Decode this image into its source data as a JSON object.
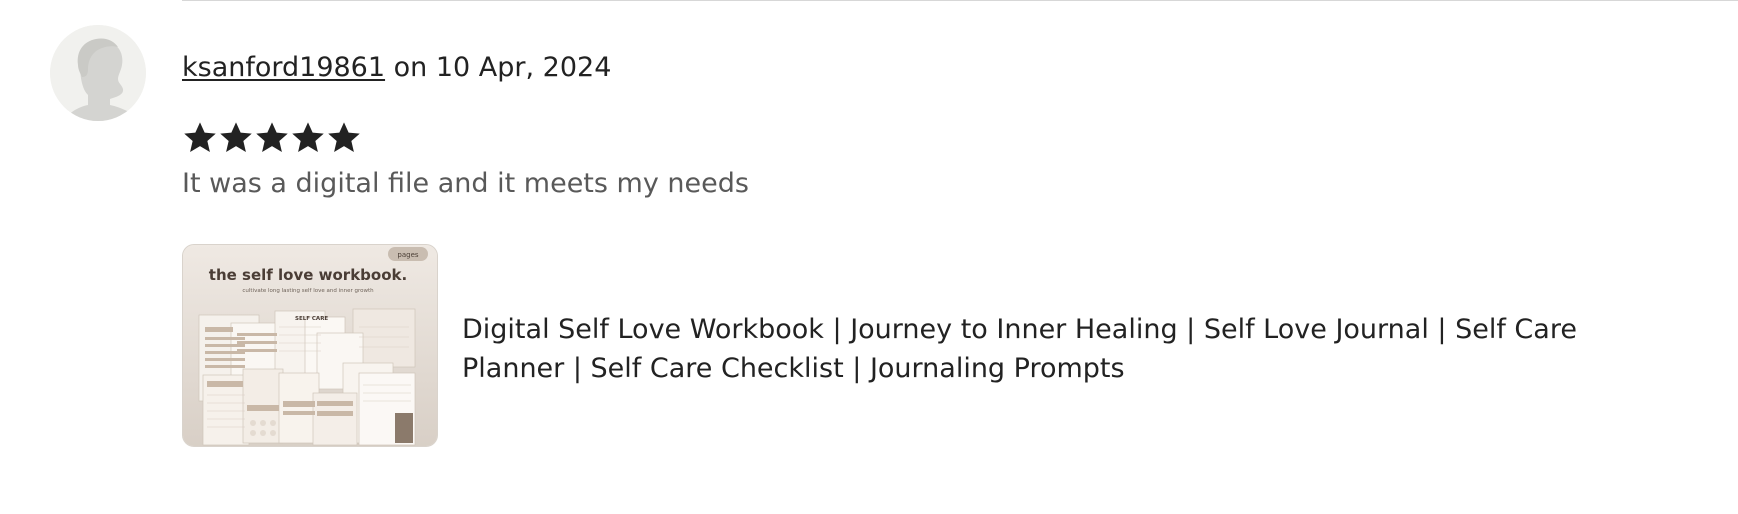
{
  "review": {
    "reviewer_name": "ksanford19861",
    "date_text": " on 10 Apr, 2024",
    "rating": 5,
    "rating_max": 5,
    "text": "It was a digital file and it meets my needs"
  },
  "listing": {
    "title": "Digital Self Love Workbook | Journey to Inner Healing | Self Love Journal | Self Care Planner | Self Care Checklist | Journaling Prompts",
    "thumbnail": {
      "heading": "the self love workbook.",
      "subheading": "cultivate long lasting self love and inner growth",
      "badge": "pages",
      "page_label": "SELF CARE"
    }
  },
  "colors": {
    "star": "#222222",
    "text_primary": "#222222",
    "text_secondary": "#595959",
    "divider": "#d7d7d7",
    "avatar_bg": "#f1f1ee",
    "avatar_silhouette": "#d4d4d1"
  }
}
